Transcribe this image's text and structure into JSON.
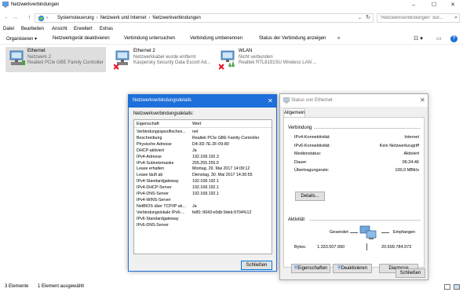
{
  "window": {
    "title": "Netzwerkverbindungen",
    "controls": {
      "minimize": "–",
      "maximize": "☐",
      "close": "✕"
    }
  },
  "address": {
    "back": "←",
    "forward": "→",
    "up": "↑",
    "crumbs": [
      "Systemsteuerung",
      "Netzwerk und Internet",
      "Netzwerkverbindungen"
    ],
    "search_placeholder": "\"Netzwerkverbindungen\" dur..."
  },
  "menu": [
    "Datei",
    "Bearbeiten",
    "Ansicht",
    "Erweitert",
    "Extras"
  ],
  "commands": [
    "Organisieren ▾",
    "Netzwerkgerät deaktivieren",
    "Verbindung untersuchen",
    "Verbindung umbenennen",
    "Status der Verbindung anzeigen",
    "»"
  ],
  "connections": [
    {
      "name": "Ethernet",
      "line2": "Netzwerk 2",
      "line3": "Realtek PCIe GBE Family Controller"
    },
    {
      "name": "Ethernet 2",
      "line2": "Netzwerkkabel wurde entfernt",
      "line3": "Kaspersky Security Data Escort Ad..."
    },
    {
      "name": "WLAN",
      "line2": "Nicht verbunden",
      "line3": "Realtek RTL8191SU Wireless LAN ..."
    }
  ],
  "statusbar": {
    "count": "3 Elemente",
    "selected": "1 Element ausgewählt"
  },
  "details": {
    "title": "Netzwerkverbindungsdetails",
    "close": "✕",
    "label": "Netzwerkverbindungsdetails:",
    "col_key": "Eigenschaft",
    "col_val": "Wert",
    "rows": [
      [
        "Verbindungsspezifisches...",
        "net"
      ],
      [
        "Beschreibung",
        "Realtek PCIe GBE Family Controller"
      ],
      [
        "Physische Adresse",
        "D4-3D-7E-2F-09-80"
      ],
      [
        "DHCP-aktiviert",
        "Ja"
      ],
      [
        "IPv4-Adresse",
        "192.168.192.3"
      ],
      [
        "IPv4-Subnetzmaske",
        "255.255.255.0"
      ],
      [
        "Lease erhalten",
        "Montag, 29. Mai 2017 14:09:12"
      ],
      [
        "Lease läuft ab",
        "Dienstag, 30. Mai 2017 14:30:55"
      ],
      [
        "IPv4-Standardgateway",
        "192.168.192.1"
      ],
      [
        "IPv4-DHCP-Server",
        "192.168.192.1"
      ],
      [
        "IPv4-DNS-Server",
        "192.168.192.1"
      ],
      [
        "IPv4-WINS-Server",
        ""
      ],
      [
        "NetBIOS über TCP/IP ak...",
        "Ja"
      ],
      [
        "Verbindungslokale IPv6-...",
        "fe80::9043:e0db:9deb:9704%12"
      ],
      [
        "IPv6-Standardgateway",
        ""
      ],
      [
        "IPv6-DNS-Server",
        ""
      ]
    ],
    "close_button": "Schließen"
  },
  "status": {
    "title": "Status von Ethernet",
    "close": "✕",
    "tab": "Allgemein",
    "connection_header": "Verbindung",
    "fields": [
      [
        "IPv4-Konnektivität:",
        "Internet"
      ],
      [
        "IPv6-Konnektivität:",
        "Kein Netzwerkzugriff"
      ],
      [
        "Medienstatus:",
        "Aktiviert"
      ],
      [
        "Dauer:",
        "06:24:46"
      ],
      [
        "Übertragungsrate:",
        "100,0 MBit/s"
      ]
    ],
    "details_button": "Details...",
    "activity_header": "Aktivität",
    "sent_label": "Gesendet",
    "received_label": "Empfangen",
    "bytes_label": "Bytes:",
    "bytes_sent": "1.333.507.990",
    "bytes_received": "20.699.784.973",
    "properties_button": "Eigenschaften",
    "disable_button": "Deaktivieren",
    "diagnose_button": "Diagnose",
    "close_button": "Schließen"
  },
  "colors": {
    "accent": "#1e6fd9",
    "selection": "#dedede",
    "error": "#e81123"
  }
}
